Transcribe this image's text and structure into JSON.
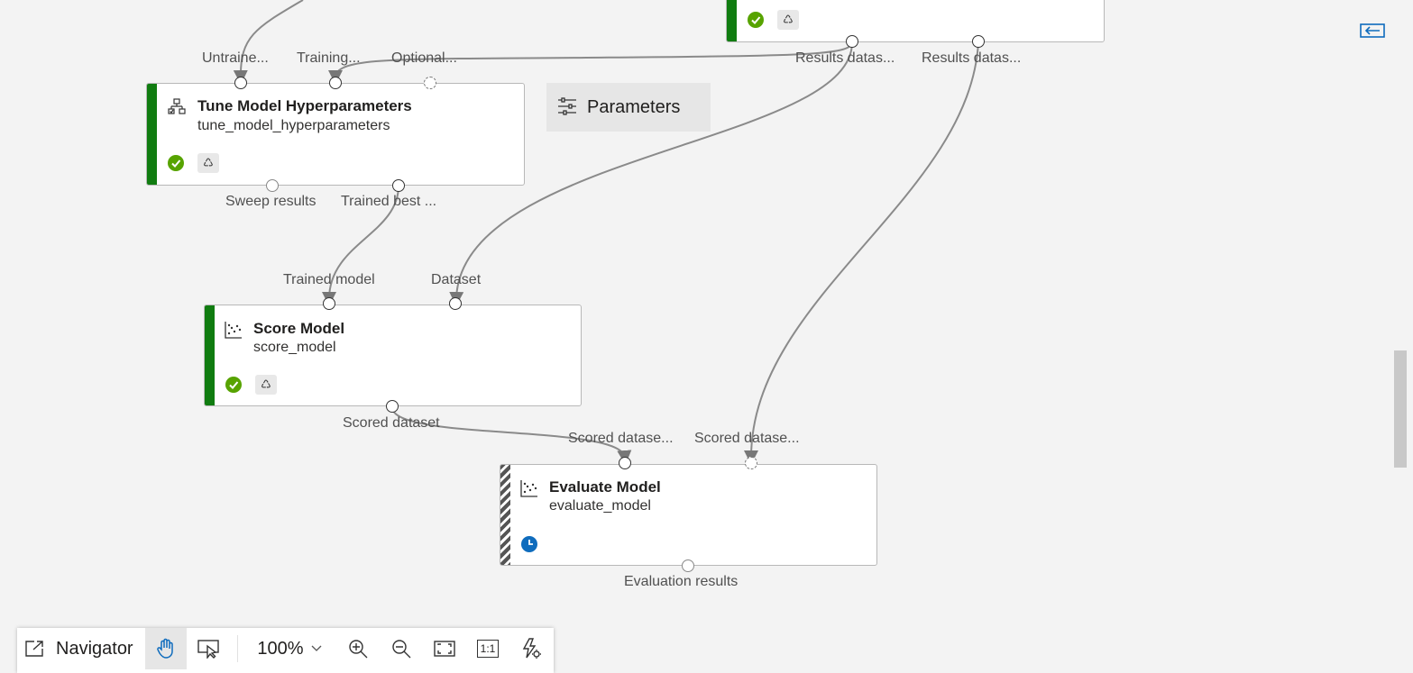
{
  "top_node": {
    "ports_out": [
      "Results datas...",
      "Results datas..."
    ]
  },
  "tune_node": {
    "title": "Tune Model Hyperparameters",
    "subtitle": "tune_model_hyperparameters",
    "ports_in": [
      "Untraine...",
      "Training...",
      "Optional..."
    ],
    "ports_out": [
      "Sweep results",
      "Trained best ..."
    ],
    "status": "completed"
  },
  "score_node": {
    "title": "Score Model",
    "subtitle": "score_model",
    "ports_in": [
      "Trained model",
      "Dataset"
    ],
    "ports_out": [
      "Scored dataset"
    ],
    "status": "completed"
  },
  "evaluate_node": {
    "title": "Evaluate Model",
    "subtitle": "evaluate_model",
    "ports_in": [
      "Scored datase...",
      "Scored datase..."
    ],
    "ports_out": [
      "Evaluation results"
    ],
    "status": "running"
  },
  "parameters_button": {
    "label": "Parameters"
  },
  "toolbar": {
    "navigator_label": "Navigator",
    "zoom_value": "100%",
    "actual_size_label": "1:1"
  },
  "colors": {
    "completed_bar": "#107c10",
    "status_ok": "#57a300",
    "status_running": "#0f6cbd",
    "accent": "#0f6cbd"
  }
}
